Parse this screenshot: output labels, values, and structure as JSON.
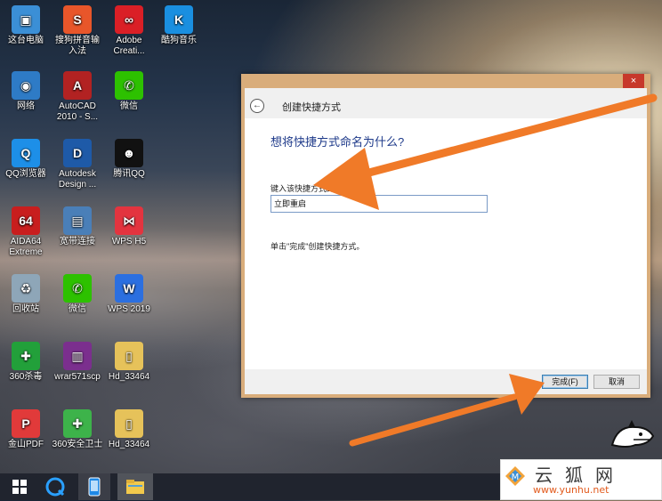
{
  "desktop": {
    "icons": [
      {
        "label": "这台电脑",
        "icon": "computer-icon",
        "color": "#3b8fd6",
        "glyph": "▣"
      },
      {
        "label": "搜狗拼音输\n入法",
        "icon": "sogou-icon",
        "color": "#e8562a",
        "glyph": "S"
      },
      {
        "label": "Adobe\nCreati...",
        "icon": "adobe-cc-icon",
        "color": "#da1f26",
        "glyph": "∞"
      },
      {
        "label": "酷狗音乐",
        "icon": "kugou-icon",
        "color": "#1a8fe0",
        "glyph": "K"
      },
      {
        "label": "网络",
        "icon": "network-icon",
        "color": "#2e7bc6",
        "glyph": "◉"
      },
      {
        "label": "AutoCAD\n2010 - S...",
        "icon": "autocad-icon",
        "color": "#b22222",
        "glyph": "A"
      },
      {
        "label": "微信",
        "icon": "wechat-icon",
        "color": "#2dc100",
        "glyph": "✆"
      },
      {
        "label": "QQ浏览器",
        "icon": "qq-browser-icon",
        "color": "#1d8fe8",
        "glyph": "Q"
      },
      {
        "label": "Autodesk\nDesign ...",
        "icon": "autodesk-design-icon",
        "color": "#1e5aa8",
        "glyph": "D"
      },
      {
        "label": "腾讯QQ",
        "icon": "qq-icon",
        "color": "#111111",
        "glyph": "☻"
      },
      {
        "label": "AIDA64\nExtreme",
        "icon": "aida64-icon",
        "color": "#c81e1e",
        "glyph": "64"
      },
      {
        "label": "宽带连接",
        "icon": "broadband-icon",
        "color": "#4a7fb8",
        "glyph": "▤"
      },
      {
        "label": "WPS H5",
        "icon": "wps-h5-icon",
        "color": "#e3343f",
        "glyph": "⋈"
      },
      {
        "label": "回收站",
        "icon": "recycle-bin-icon",
        "color": "#8ea6b8",
        "glyph": "♻"
      },
      {
        "label": "微信",
        "icon": "wechat-icon",
        "color": "#2dc100",
        "glyph": "✆"
      },
      {
        "label": "WPS 2019",
        "icon": "wps-2019-icon",
        "color": "#2b6fe0",
        "glyph": "W"
      },
      {
        "label": "360杀毒",
        "icon": "antivirus-360-icon",
        "color": "#22a03a",
        "glyph": "✚"
      },
      {
        "label": "wrar571scp",
        "icon": "winrar-icon",
        "color": "#7b2f8e",
        "glyph": "▥"
      },
      {
        "label": "Hd_33464",
        "icon": "folder-icon",
        "color": "#e6c25a",
        "glyph": "▯"
      },
      {
        "label": "金山PDF",
        "icon": "kingsoft-pdf-icon",
        "color": "#e13a3a",
        "glyph": "P"
      },
      {
        "label": "360安全卫士",
        "icon": "security-360-icon",
        "color": "#3db34a",
        "glyph": "✚"
      },
      {
        "label": "Hd_33464",
        "icon": "folder-icon",
        "color": "#e6c25a",
        "glyph": "▯"
      }
    ]
  },
  "dialog": {
    "close_glyph": "×",
    "back_glyph": "←",
    "title": "创建快捷方式",
    "heading": "想将快捷方式命名为什么?",
    "field_label": "键入该快捷方式的名",
    "name_value": "立即重启",
    "hint": "单击\"完成\"创建快捷方式。",
    "finish_label": "完成(F)",
    "cancel_label": "取消"
  },
  "taskbar": {
    "start_icon": "windows-start-icon",
    "items": [
      "qq-browser-icon",
      "phone-icon",
      "file-explorer-icon"
    ]
  },
  "watermark": {
    "chars": "云狐网",
    "url": "www.yunhu.net"
  },
  "colors": {
    "arrow": "#f07a28",
    "dialog_frame": "#d9ad7b",
    "heading": "#1e3a8a"
  }
}
